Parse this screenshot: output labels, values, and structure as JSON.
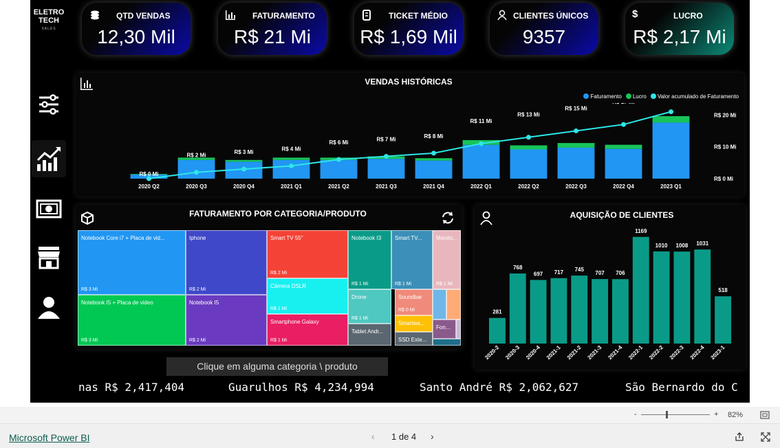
{
  "brand": {
    "line1": "ELETRO",
    "line2": "TECH",
    "sub": "SALES"
  },
  "nav": [
    "filters-icon",
    "trend-chart-icon",
    "money-icon",
    "store-icon",
    "user-icon"
  ],
  "kpis": [
    {
      "label": "QTD VENDAS",
      "value": "12,30 Mil",
      "icon": "coins-icon"
    },
    {
      "label": "FATURAMENTO",
      "value": "R$ 21 Mi",
      "icon": "bar-chart-icon"
    },
    {
      "label": "TICKET MÉDIO",
      "value": "R$ 1,69 Mil",
      "icon": "ticket-icon"
    },
    {
      "label": "CLIENTES ÚNICOS",
      "value": "9357",
      "icon": "user-icon"
    },
    {
      "label": "LUCRO",
      "value": "R$ 2,17 Mi",
      "icon": "dollar-icon"
    }
  ],
  "colors": {
    "faturamento": "#2196f3",
    "lucro": "#18c45a",
    "acumulado": "#2ee6e6",
    "kpi_blue": "#0a0aa8",
    "kpi_green": "#0c8a78",
    "teal": "#0a9b88"
  },
  "chart_data": [
    {
      "type": "bar",
      "title": "VENDAS HISTÓRICAS",
      "categories": [
        "2020 Q2",
        "2020 Q3",
        "2020 Q4",
        "2021 Q1",
        "2021 Q2",
        "2021 Q3",
        "2021 Q4",
        "2022 Q1",
        "2022 Q2",
        "2022 Q3",
        "2022 Q4",
        "2023 Q1"
      ],
      "series": [
        {
          "name": "Faturamento",
          "values": [
            0.35,
            1.6,
            1.45,
            1.6,
            1.6,
            1.7,
            1.55,
            2.9,
            2.5,
            2.65,
            2.55,
            4.8
          ]
        },
        {
          "name": "Lucro",
          "values": [
            0.05,
            0.2,
            0.15,
            0.2,
            0.2,
            0.2,
            0.2,
            0.4,
            0.35,
            0.4,
            0.35,
            0.55
          ]
        },
        {
          "name": "Valor acumulado de Faturamento",
          "values": [
            0,
            2,
            3,
            4,
            6,
            7,
            8,
            11,
            13,
            15,
            17,
            21
          ]
        }
      ],
      "point_labels": [
        "R$ 0 Mi",
        "R$ 2 Mi",
        "R$ 3 Mi",
        "R$ 4 Mi",
        "R$ 6 Mi",
        "R$ 7 Mi",
        "R$ 8 Mi",
        "R$ 11 Mi",
        "R$ 13 Mi",
        "R$ 15 Mi",
        "R$ 17 Mi",
        "R$ 21 Mi"
      ],
      "y_ticks": [
        "R$ 20 Mi",
        "R$ 10 Mi",
        "R$ 0 Mi"
      ],
      "ylim": [
        0,
        22
      ],
      "legend": "top-right",
      "grid": false
    },
    {
      "type": "bar",
      "title": "AQUISIÇÃO DE CLIENTES",
      "categories": [
        "2020-2",
        "2020-3",
        "2020-4",
        "2021-1",
        "2021-2",
        "2021-3",
        "2021-4",
        "2022-1",
        "2022-2",
        "2022-3",
        "2022-4",
        "2023-1"
      ],
      "values": [
        281,
        768,
        697,
        717,
        745,
        707,
        706,
        1169,
        1010,
        1008,
        1031,
        518
      ],
      "ylim": [
        0,
        1250
      ],
      "grid": false
    }
  ],
  "treemap": {
    "title": "FATURAMENTO POR CATEGORIA/PRODUTO",
    "cells": [
      {
        "name": "Notebook Core i7 + Placa de vid...",
        "value": "R$ 3 Mi",
        "color": "#2196f3"
      },
      {
        "name": "Iphone",
        "value": "R$ 2 Mi",
        "color": "#3f48c8"
      },
      {
        "name": "Smart TV 55\"",
        "value": "R$ 2 Mi",
        "color": "#f44336"
      },
      {
        "name": "Notebook I3",
        "value": "R$ 1 Mi",
        "color": "#0a9b88"
      },
      {
        "name": "Smart TV...",
        "value": "R$ 1 Mi",
        "color": "#3b8fb8"
      },
      {
        "name": "Monito...",
        "value": "R$ 1 Mi",
        "color": "#e8b7bd"
      },
      {
        "name": "Notebook I5 + Placa de video",
        "value": "R$ 3 Mi",
        "color": "#00c853"
      },
      {
        "name": "Notebook I5",
        "value": "R$ 2 Mi",
        "color": "#6a3bc0"
      },
      {
        "name": "Câmera DSLR",
        "value": "R$ 1 Mi",
        "color": "#18f0f0"
      },
      {
        "name": "Smartphone Galaxy",
        "value": "R$ 1 Mi",
        "color": "#e91e63"
      },
      {
        "name": "Drone",
        "value": "R$ 1 Mi",
        "color": "#4ec8c0"
      },
      {
        "name": "Soundbar",
        "value": "R$ 0 Mi",
        "color": "#f08a7a"
      },
      {
        "name": "Smartwa...",
        "value": "",
        "color": "#ffc107"
      },
      {
        "name": "Tablet Andr...",
        "value": "",
        "color": "#5a6670"
      },
      {
        "name": "SSD Exte...",
        "value": "",
        "color": "#5a6670"
      },
      {
        "name": "Fon...",
        "value": "",
        "color": "#8b5a8c"
      }
    ],
    "extra_colors": [
      "#6fb7e8",
      "#ffab76",
      "#c9b8d8",
      "#1e6e8a"
    ]
  },
  "hint": "Clique em alguma categoria \\ produto",
  "ticker": [
    "nas R$ 2,417,404",
    "Guarulhos R$ 4,234,994",
    "Santo André R$ 2,062,627",
    "São Bernardo do C"
  ],
  "zoom": {
    "minus": "-",
    "plus": "+",
    "value": "82%"
  },
  "footer": {
    "brand": "Microsoft Power BI",
    "page": "1 de 4"
  }
}
